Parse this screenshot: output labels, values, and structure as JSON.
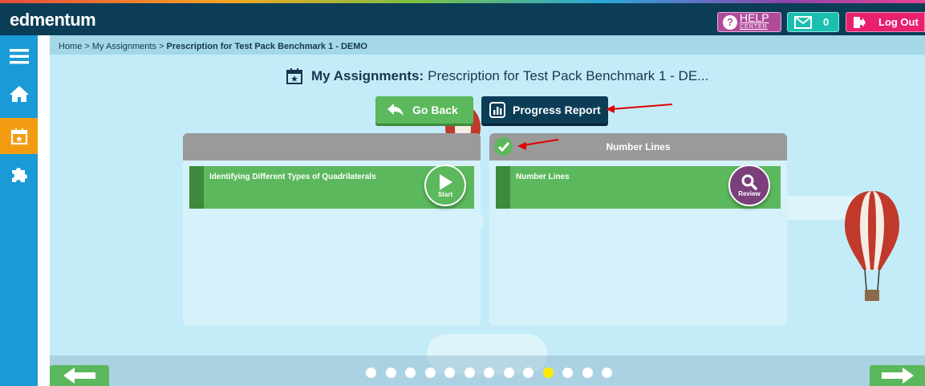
{
  "header": {
    "logo": "edmentum",
    "help": {
      "label": "HELP",
      "sublabel": "CENTER"
    },
    "messages": {
      "count": "0"
    },
    "logout_label": "Log Out"
  },
  "sidebar": {
    "items": [
      {
        "name": "menu",
        "icon": "hamburger-icon"
      },
      {
        "name": "home",
        "icon": "home-icon"
      },
      {
        "name": "assignments",
        "icon": "calendar-star-icon",
        "active": true
      },
      {
        "name": "puzzle",
        "icon": "puzzle-icon"
      }
    ]
  },
  "breadcrumb": {
    "home": "Home",
    "sep1": " > ",
    "assignments": "My Assignments",
    "sep2": " > ",
    "current": "Prescription for Test Pack Benchmark 1 - DEMO"
  },
  "title": {
    "label": "My Assignments:",
    "value": "Prescription for Test Pack Benchmark 1 - DE..."
  },
  "actions": {
    "go_back": "Go Back",
    "progress_report": "Progress Report"
  },
  "cards": [
    {
      "header": "",
      "completed": false,
      "lesson_title": "Identifying Different Types of Quadrilaterals",
      "action": "Start"
    },
    {
      "header": "Number Lines",
      "completed": true,
      "lesson_title": "Number Lines",
      "action": "Review"
    }
  ],
  "pagination": {
    "total": 13,
    "active_index": 9
  },
  "colors": {
    "header_bg": "#0b3d57",
    "sidebar_bg": "#1a9ad6",
    "active_tab": "#f39c12",
    "content_bg": "#c3ecf8",
    "green": "#5cb85c",
    "review_purple": "#7b3f7b",
    "annotation_red": "#e00000"
  }
}
